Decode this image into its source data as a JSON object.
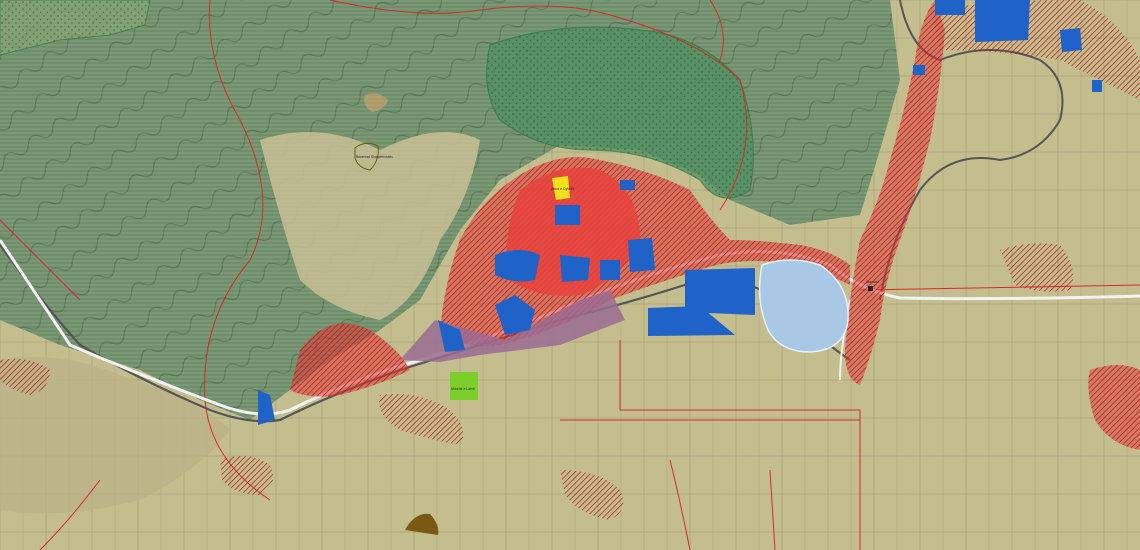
{
  "map": {
    "colors": {
      "mountain": "#6f8f6a",
      "plain": "#c8c294",
      "residential": "#e23a3a",
      "public_facility": "#1f63c9",
      "lake": "#a9c8e6",
      "industrial": "#9b6c92",
      "forest": "#4f8f62",
      "park": "#7ccf2a",
      "commercial": "#f5e11a",
      "other": "#7a5a12",
      "boundary": "#d62a2a",
      "road": "#f2f2f2"
    },
    "labels": {
      "north_label": "Rezervat Shqipërishtës",
      "park_label": "Shkolla e Lartë",
      "yellow_label": "Zona e Qytetit",
      "station_label": "Stacioni"
    }
  }
}
